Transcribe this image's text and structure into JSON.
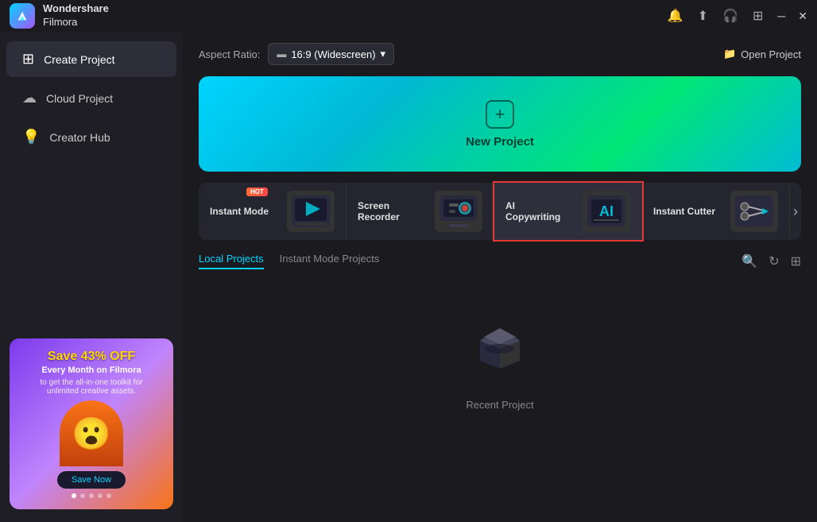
{
  "titlebar": {
    "app_name_line1": "Wondershare",
    "app_name_line2": "Filmora"
  },
  "sidebar": {
    "items": [
      {
        "id": "create-project",
        "label": "Create Project",
        "active": true
      },
      {
        "id": "cloud-project",
        "label": "Cloud Project",
        "active": false
      },
      {
        "id": "creator-hub",
        "label": "Creator Hub",
        "active": false
      }
    ]
  },
  "ad": {
    "save_text": "Save 43% OFF",
    "body_text": "Every Month on Filmora",
    "sub_text": "to get the all-in-one toolkit for\nunlimited creative assets.",
    "btn_label": "Save Now"
  },
  "toolbar": {
    "aspect_label": "Aspect Ratio:",
    "aspect_value": "16:9 (Widescreen)",
    "open_project_label": "Open Project"
  },
  "new_project": {
    "label": "New Project"
  },
  "features": [
    {
      "id": "instant-mode",
      "title": "Instant Mode",
      "badge": "HOT",
      "icon": "🎬"
    },
    {
      "id": "screen-recorder",
      "title": "Screen Recorder",
      "icon": "🖥️"
    },
    {
      "id": "ai-copywriting",
      "title": "AI Copywriting",
      "active": true,
      "icon": "🤖"
    },
    {
      "id": "instant-cutter",
      "title": "Instant Cutter",
      "icon": "✂️"
    }
  ],
  "tabs": {
    "items": [
      {
        "id": "local-projects",
        "label": "Local Projects",
        "active": true
      },
      {
        "id": "instant-mode-projects",
        "label": "Instant Mode Projects",
        "active": false
      }
    ]
  },
  "empty_state": {
    "label": "Recent Project"
  }
}
